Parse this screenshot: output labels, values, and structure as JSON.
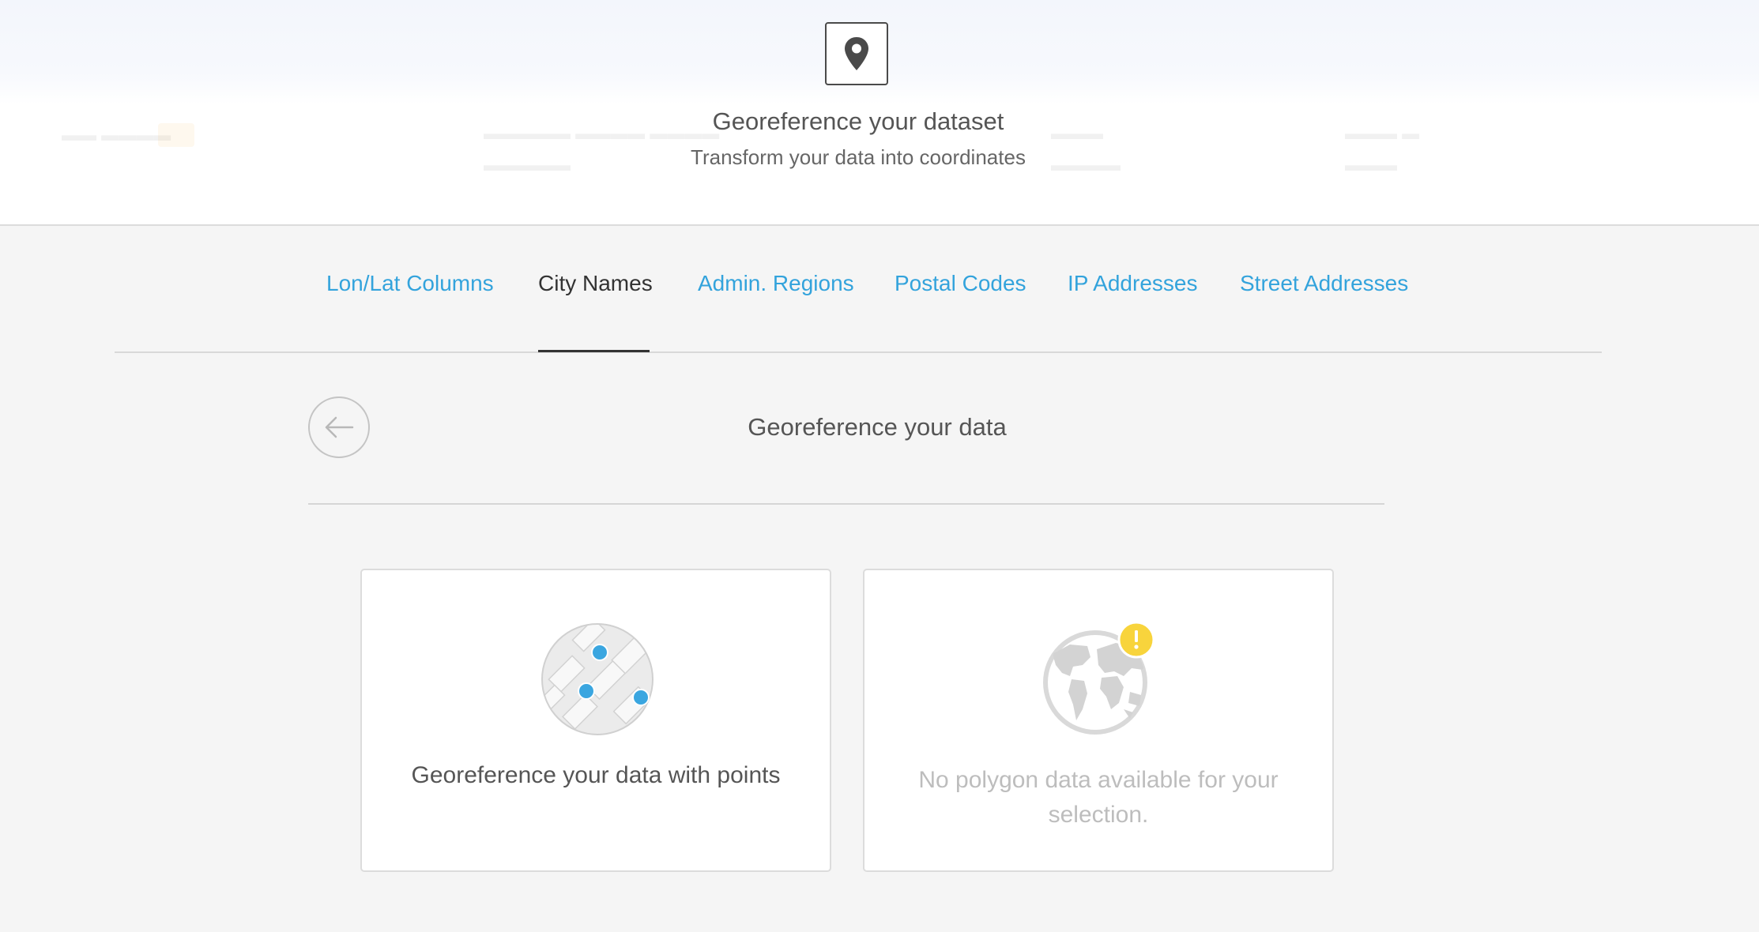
{
  "modal": {
    "icon": "map-pin-icon",
    "title": "Georeference your dataset",
    "subtitle": "Transform your data into coordinates"
  },
  "tabs": [
    {
      "label": "Lon/Lat Columns",
      "active": false
    },
    {
      "label": "City Names",
      "active": true
    },
    {
      "label": "Admin. Regions",
      "active": false
    },
    {
      "label": "Postal Codes",
      "active": false
    },
    {
      "label": "IP Addresses",
      "active": false
    },
    {
      "label": "Street Addresses",
      "active": false
    }
  ],
  "section": {
    "back_icon": "arrow-left-icon",
    "title": "Georeference your data"
  },
  "options": [
    {
      "id": "points",
      "icon": "map-points-icon",
      "label": "Georeference your data with points",
      "enabled": true
    },
    {
      "id": "polygons",
      "icon": "globe-warning-icon",
      "label": "No polygon data available for your selection.",
      "enabled": false
    }
  ],
  "colors": {
    "link": "#33a3dc",
    "active_tab": "#333333",
    "point_marker": "#3aa6e0",
    "warning_badge": "#f8d43c",
    "disabled_text": "#bdbdbd"
  }
}
